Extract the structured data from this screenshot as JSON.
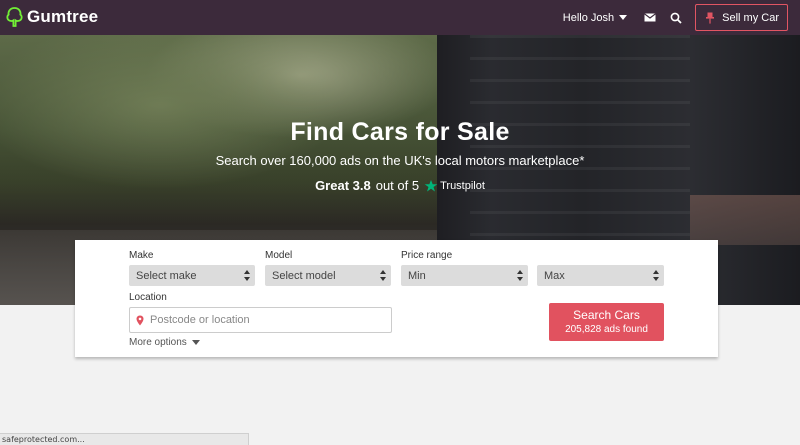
{
  "nav": {
    "brand": "Gumtree",
    "greeting": "Hello Josh",
    "sell_label": "Sell my Car",
    "icons": [
      "tree-logo-icon",
      "caret-down-icon",
      "mail-icon",
      "search-icon",
      "pin-icon"
    ],
    "colors": {
      "bar": "#3c2a3b",
      "accent": "#e25563"
    }
  },
  "hero": {
    "title": "Find Cars for Sale",
    "subtitle": "Search over 160,000 ads on the UK's local motors marketplace*",
    "rating_word": "Great 3.8",
    "rating_suffix": "out of 5",
    "trustpilot": "Trustpilot"
  },
  "search": {
    "make_label": "Make",
    "make_value": "Select make",
    "model_label": "Model",
    "model_value": "Select model",
    "price_label": "Price range",
    "price_min": "Min",
    "price_max": "Max",
    "location_label": "Location",
    "location_placeholder": "Postcode or location",
    "more_options": "More options",
    "button_label": "Search Cars",
    "button_count": "205,828 ads found",
    "button_color": "#e1525f"
  },
  "status_bar": {
    "text": "safeprotected.com..."
  }
}
